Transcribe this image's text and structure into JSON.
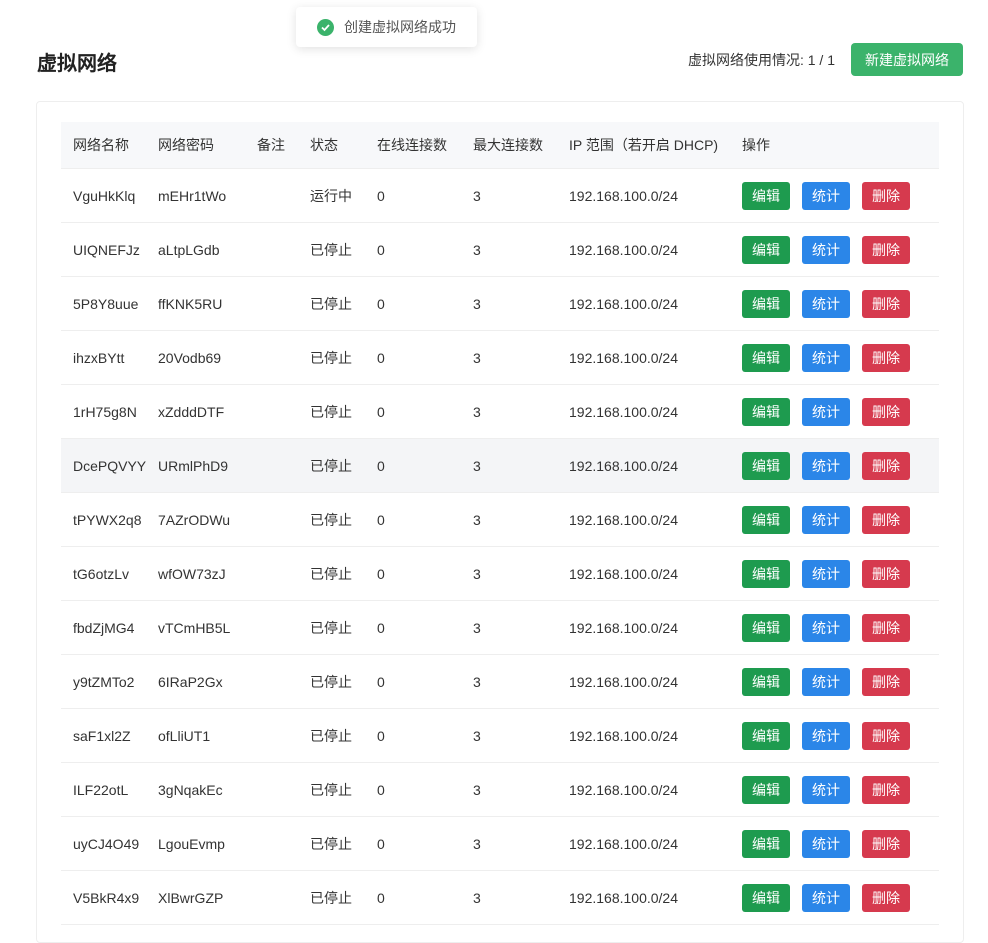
{
  "page": {
    "title": "虚拟网络",
    "usage_text": "虚拟网络使用情况: 1 / 1",
    "create_button": "新建虚拟网络"
  },
  "toast": {
    "message": "创建虚拟网络成功",
    "icon": "check-circle-icon",
    "color": "#3bb36b"
  },
  "table": {
    "columns": [
      "网络名称",
      "网络密码",
      "备注",
      "状态",
      "在线连接数",
      "最大连接数",
      "IP 范围（若开启 DHCP)",
      "操作"
    ],
    "actions": {
      "edit": "编辑",
      "stats": "统计",
      "delete": "删除"
    },
    "rows": [
      {
        "name": "VguHkKlq",
        "password": "mEHr1tWo",
        "note": "",
        "status": "运行中",
        "online": "0",
        "max": "3",
        "ip": "192.168.100.0/24"
      },
      {
        "name": "UIQNEFJz",
        "password": "aLtpLGdb",
        "note": "",
        "status": "已停止",
        "online": "0",
        "max": "3",
        "ip": "192.168.100.0/24"
      },
      {
        "name": "5P8Y8uue",
        "password": "ffKNK5RU",
        "note": "",
        "status": "已停止",
        "online": "0",
        "max": "3",
        "ip": "192.168.100.0/24"
      },
      {
        "name": "ihzxBYtt",
        "password": "20Vodb69",
        "note": "",
        "status": "已停止",
        "online": "0",
        "max": "3",
        "ip": "192.168.100.0/24"
      },
      {
        "name": "1rH75g8N",
        "password": "xZdddDTF",
        "note": "",
        "status": "已停止",
        "online": "0",
        "max": "3",
        "ip": "192.168.100.0/24"
      },
      {
        "name": "DcePQVYY",
        "password": "URmlPhD9",
        "note": "",
        "status": "已停止",
        "online": "0",
        "max": "3",
        "ip": "192.168.100.0/24"
      },
      {
        "name": "tPYWX2q8",
        "password": "7AZrODWu",
        "note": "",
        "status": "已停止",
        "online": "0",
        "max": "3",
        "ip": "192.168.100.0/24"
      },
      {
        "name": "tG6otzLv",
        "password": "wfOW73zJ",
        "note": "",
        "status": "已停止",
        "online": "0",
        "max": "3",
        "ip": "192.168.100.0/24"
      },
      {
        "name": "fbdZjMG4",
        "password": "vTCmHB5L",
        "note": "",
        "status": "已停止",
        "online": "0",
        "max": "3",
        "ip": "192.168.100.0/24"
      },
      {
        "name": "y9tZMTo2",
        "password": "6IRaP2Gx",
        "note": "",
        "status": "已停止",
        "online": "0",
        "max": "3",
        "ip": "192.168.100.0/24"
      },
      {
        "name": "saF1xl2Z",
        "password": "ofLliUT1",
        "note": "",
        "status": "已停止",
        "online": "0",
        "max": "3",
        "ip": "192.168.100.0/24"
      },
      {
        "name": "ILF22otL",
        "password": "3gNqakEc",
        "note": "",
        "status": "已停止",
        "online": "0",
        "max": "3",
        "ip": "192.168.100.0/24"
      },
      {
        "name": "uyCJ4O49",
        "password": "LgouEvmp",
        "note": "",
        "status": "已停止",
        "online": "0",
        "max": "3",
        "ip": "192.168.100.0/24"
      },
      {
        "name": "V5BkR4x9",
        "password": "XlBwrGZP",
        "note": "",
        "status": "已停止",
        "online": "0",
        "max": "3",
        "ip": "192.168.100.0/24"
      }
    ]
  }
}
